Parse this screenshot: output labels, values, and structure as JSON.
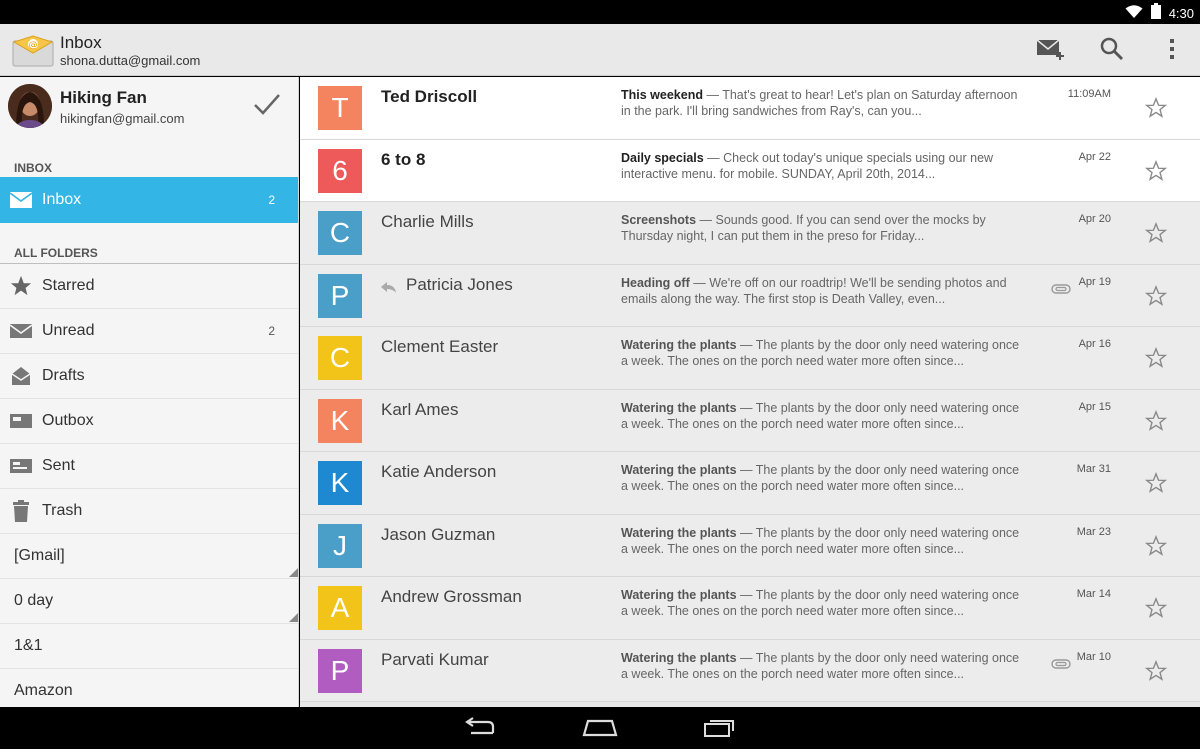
{
  "status_bar": {
    "time": "4:30"
  },
  "action_bar": {
    "title": "Inbox",
    "account_email": "shona.dutta@gmail.com"
  },
  "drawer": {
    "account": {
      "name": "Hiking Fan",
      "email": "hikingfan@gmail.com"
    },
    "inbox_header": "INBOX",
    "selected_folder": {
      "label": "Inbox",
      "count": "2"
    },
    "all_folders_header": "ALL FOLDERS",
    "folders": [
      {
        "label": "Starred",
        "icon": "star-icon",
        "count": ""
      },
      {
        "label": "Unread",
        "icon": "unread-icon",
        "count": "2"
      },
      {
        "label": "Drafts",
        "icon": "drafts-icon",
        "count": ""
      },
      {
        "label": "Outbox",
        "icon": "outbox-icon",
        "count": ""
      },
      {
        "label": "Sent",
        "icon": "sent-icon",
        "count": ""
      },
      {
        "label": "Trash",
        "icon": "trash-icon",
        "count": ""
      },
      {
        "label": "[Gmail]",
        "icon": "",
        "count": ""
      },
      {
        "label": "0 day",
        "icon": "",
        "count": ""
      },
      {
        "label": "1&1",
        "icon": "",
        "count": ""
      },
      {
        "label": "Amazon",
        "icon": "",
        "count": ""
      }
    ]
  },
  "conversations": [
    {
      "letter": "T",
      "color": "#f4845f",
      "sender": "Ted Driscoll",
      "subject": "This weekend",
      "snippet": " — That's great to hear! Let's plan on Saturday afternoon in the park. I'll bring sandwiches from Ray's, can you...",
      "date": "11:09AM",
      "unread": true,
      "replied": false,
      "attachment": false
    },
    {
      "letter": "6",
      "color": "#ee5a5a",
      "sender": "6 to 8",
      "subject": "Daily specials",
      "snippet": " — Check out today's unique specials using our new interactive menu. for mobile. SUNDAY, April 20th, 2014...",
      "date": "Apr 22",
      "unread": true,
      "replied": false,
      "attachment": false
    },
    {
      "letter": "C",
      "color": "#4a9fc8",
      "sender": "Charlie Mills",
      "subject": "Screenshots",
      "snippet": " — Sounds good. If you can send over the mocks by Thursday night, I can put them in the preso for Friday...",
      "date": "Apr 20",
      "unread": false,
      "replied": false,
      "attachment": false
    },
    {
      "letter": "P",
      "color": "#4a9fc8",
      "sender": "Patricia Jones",
      "subject": "Heading off",
      "snippet": " — We're off on our roadtrip! We'll be sending photos and emails along the way. The first stop is Death Valley, even...",
      "date": "Apr 19",
      "unread": false,
      "replied": true,
      "attachment": true
    },
    {
      "letter": "C",
      "color": "#f2c318",
      "sender": "Clement Easter",
      "subject": "Watering the plants",
      "snippet": " — The plants by the door only need watering once a week. The ones on the porch need water more often since...",
      "date": "Apr 16",
      "unread": false,
      "replied": false,
      "attachment": false
    },
    {
      "letter": "K",
      "color": "#f4845f",
      "sender": "Karl Ames",
      "subject": "Watering the plants",
      "snippet": " — The plants by the door only need watering once a week. The ones on the porch need water more often since...",
      "date": "Apr 15",
      "unread": false,
      "replied": false,
      "attachment": false
    },
    {
      "letter": "K",
      "color": "#1e88d0",
      "sender": "Katie Anderson",
      "subject": "Watering the plants",
      "snippet": " — The plants by the door only need watering once a week. The ones on the porch need water more often since...",
      "date": "Mar 31",
      "unread": false,
      "replied": false,
      "attachment": false
    },
    {
      "letter": "J",
      "color": "#4a9fc8",
      "sender": "Jason Guzman",
      "subject": "Watering the plants",
      "snippet": " — The plants by the door only need watering once a week. The ones on the porch need water more often since...",
      "date": "Mar 23",
      "unread": false,
      "replied": false,
      "attachment": false
    },
    {
      "letter": "A",
      "color": "#f2c318",
      "sender": "Andrew Grossman",
      "subject": "Watering the plants",
      "snippet": " — The plants by the door only need watering once a week. The ones on the porch need water more often since...",
      "date": "Mar 14",
      "unread": false,
      "replied": false,
      "attachment": false
    },
    {
      "letter": "P",
      "color": "#b05cc0",
      "sender": "Parvati Kumar",
      "subject": "Watering the plants",
      "snippet": " — The plants by the door only need watering once a week. The ones on the porch need water more often since...",
      "date": "Mar 10",
      "unread": false,
      "replied": false,
      "attachment": true
    }
  ]
}
